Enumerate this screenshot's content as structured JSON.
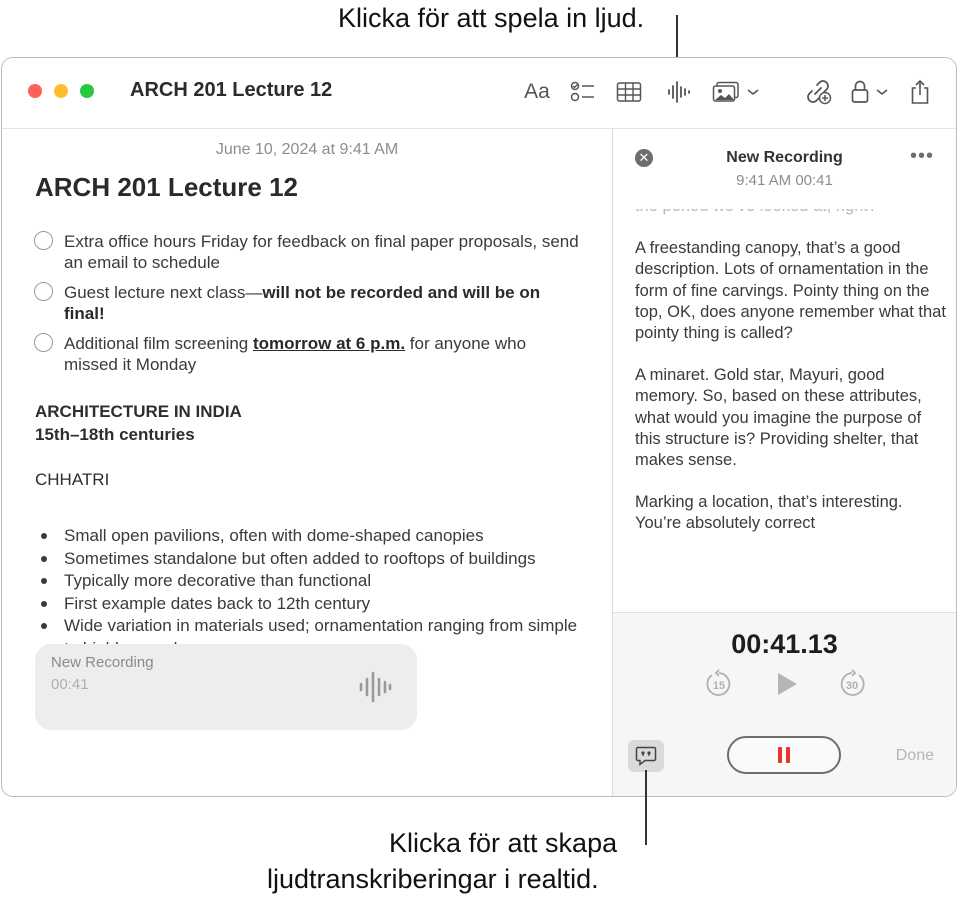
{
  "callouts": {
    "record_audio": "Klicka för att spela in ljud.",
    "transcription_line1": "Klicka för att skapa",
    "transcription_line2": "ljudtranskriberingar i realtid."
  },
  "window": {
    "title": "ARCH 201 Lecture 12",
    "toolbar": {
      "format_label": "Aa",
      "icons": [
        "checklist-icon",
        "table-icon",
        "audio-waveform-icon",
        "media-icon",
        "collaborate-icon",
        "lock-icon",
        "share-icon"
      ]
    }
  },
  "note": {
    "date": "June 10, 2024 at 9:41 AM",
    "title": "ARCH 201 Lecture 12",
    "todos": [
      {
        "text": "Extra office hours Friday for feedback on final paper proposals, send an email to schedule"
      },
      {
        "pre": "Guest lecture next class—",
        "bold": "will not be recorded and will be on final!"
      },
      {
        "pre": "Additional film screening ",
        "emph": "tomorrow at 6 p.m.",
        "post": " for anyone who missed it Monday"
      }
    ],
    "heading1": "ARCHITECTURE IN INDIA",
    "heading2": "15th–18th centuries",
    "subheading": "CHHATRI",
    "bullets": [
      "Small open pavilions, often with dome-shaped canopies",
      "Sometimes standalone but often added to rooftops of buildings",
      "Typically more decorative than functional",
      "First example dates back to 12th century",
      "Wide variation in materials used; ornamentation ranging from simple to highly complex"
    ],
    "recording_card": {
      "title": "New Recording",
      "duration": "00:41"
    }
  },
  "panel": {
    "title": "New Recording",
    "subtitle": "9:41 AM 00:41",
    "transcript_faded": "the period we’ve looked at, right?",
    "transcript": [
      "A freestanding canopy, that’s a good description. Lots of ornamentation in the form of fine carvings. Pointy thing on the top, OK, does anyone remember what that pointy thing is called?",
      "A minaret. Gold star, Mayuri, good memory. So, based on these attributes, what would you imagine the purpose of this structure is? Providing shelter, that makes sense.",
      "Marking a location, that’s interesting. You’re absolutely correct"
    ],
    "timer": "00:41.13",
    "skip_back": "15",
    "skip_forward": "30",
    "done_label": "Done",
    "colors": {
      "record_red": "#e8352b"
    }
  }
}
